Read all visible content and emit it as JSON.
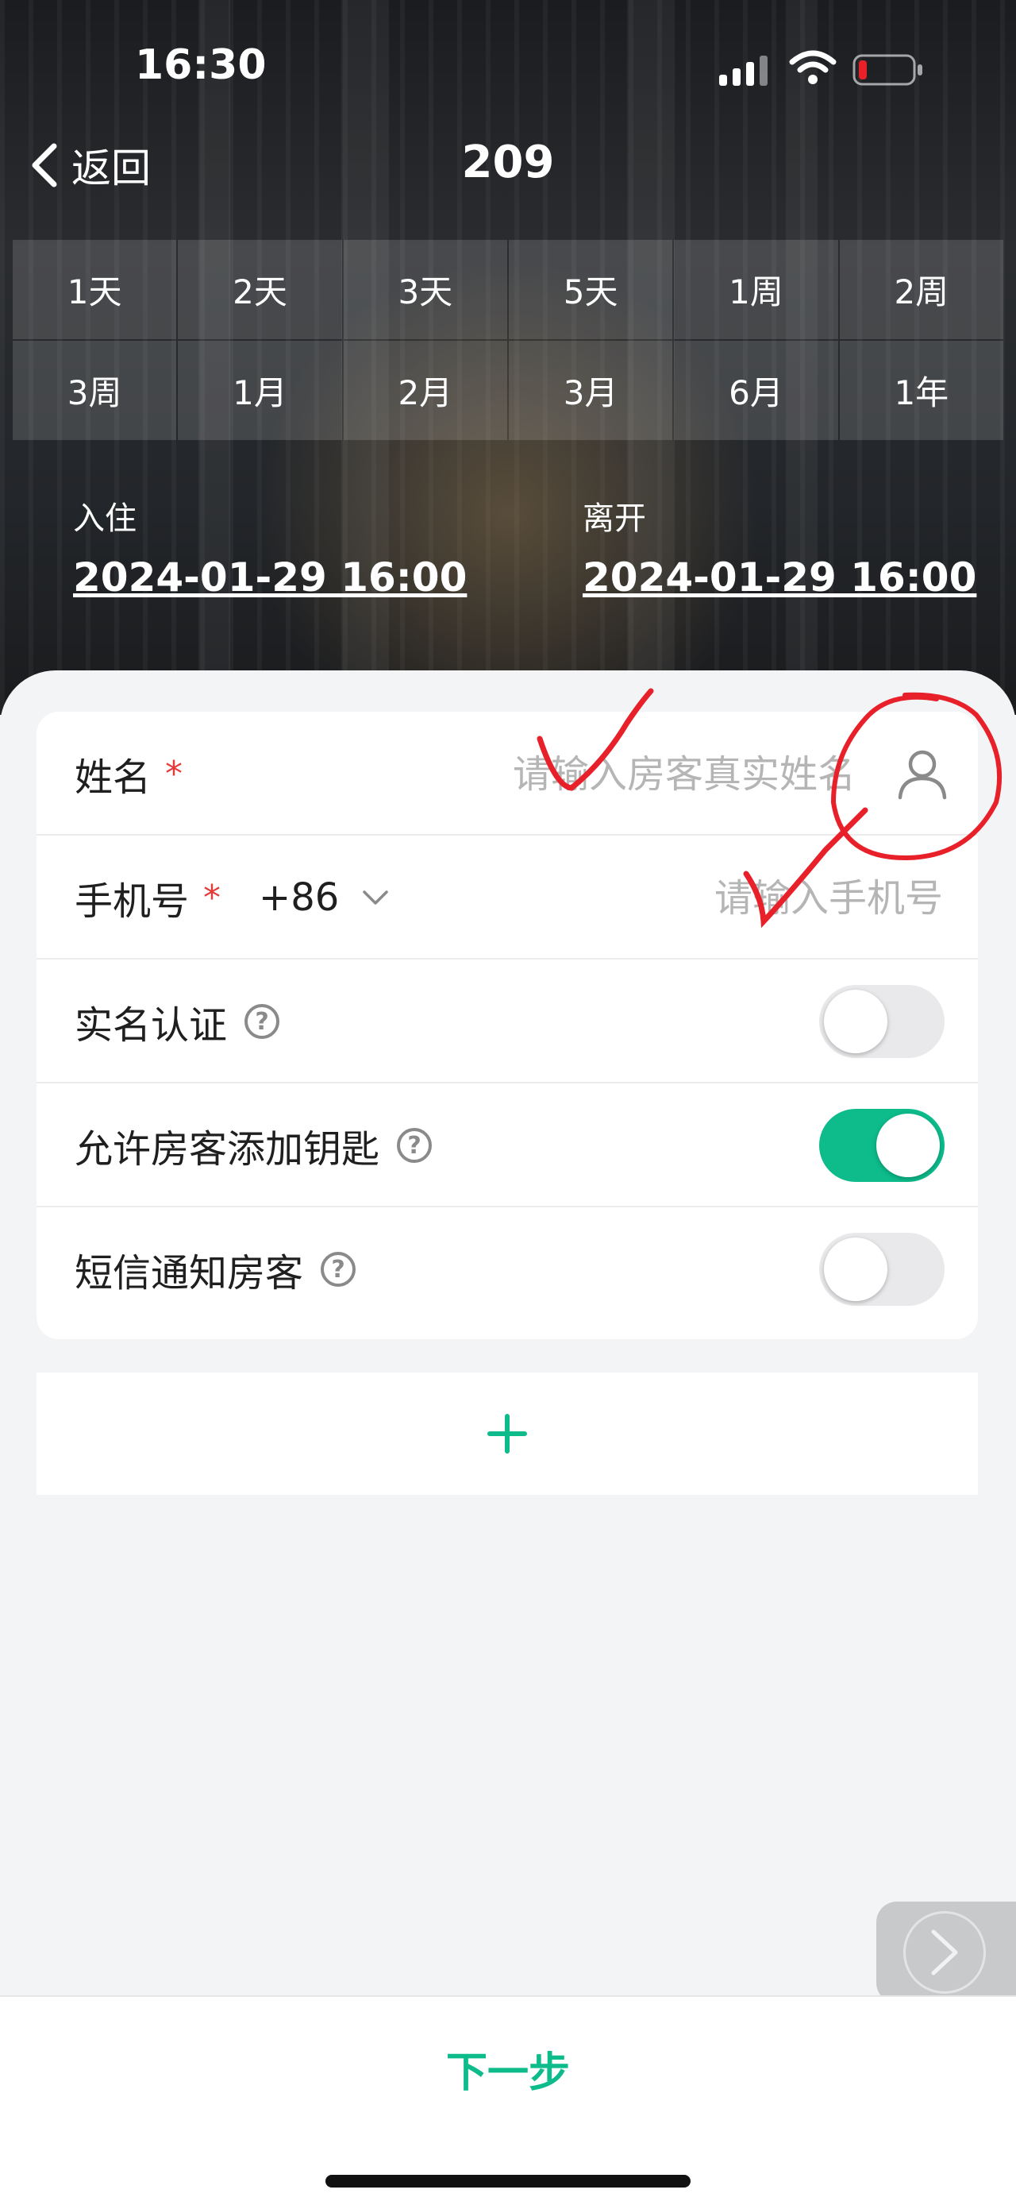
{
  "status_bar": {
    "time": "16:30",
    "icons": [
      "signal-icon",
      "wifi-icon",
      "battery-low-icon"
    ]
  },
  "nav": {
    "back_label": "返回",
    "title": "209"
  },
  "durations": [
    "1天",
    "2天",
    "3天",
    "5天",
    "1周",
    "2周",
    "3周",
    "1月",
    "2月",
    "3月",
    "6月",
    "1年"
  ],
  "dates": {
    "checkin_label": "入住",
    "checkin_value": "2024-01-29 16:00",
    "checkout_label": "离开",
    "checkout_value": "2024-01-29 16:00"
  },
  "form": {
    "name_label": "姓名",
    "name_placeholder": "请输入房客真实姓名",
    "phone_label": "手机号",
    "country_code": "+86",
    "phone_placeholder": "请输入手机号",
    "required_mark": "*",
    "help_mark": "?",
    "realname_label": "实名认证",
    "realname_on": false,
    "allow_keys_label": "允许房客添加钥匙",
    "allow_keys_on": true,
    "sms_label": "短信通知房客",
    "sms_on": false
  },
  "footer": {
    "next_label": "下一步"
  },
  "colors": {
    "accent": "#0dbb8b",
    "required": "#e33b3b",
    "annotation": "#e8202a"
  }
}
